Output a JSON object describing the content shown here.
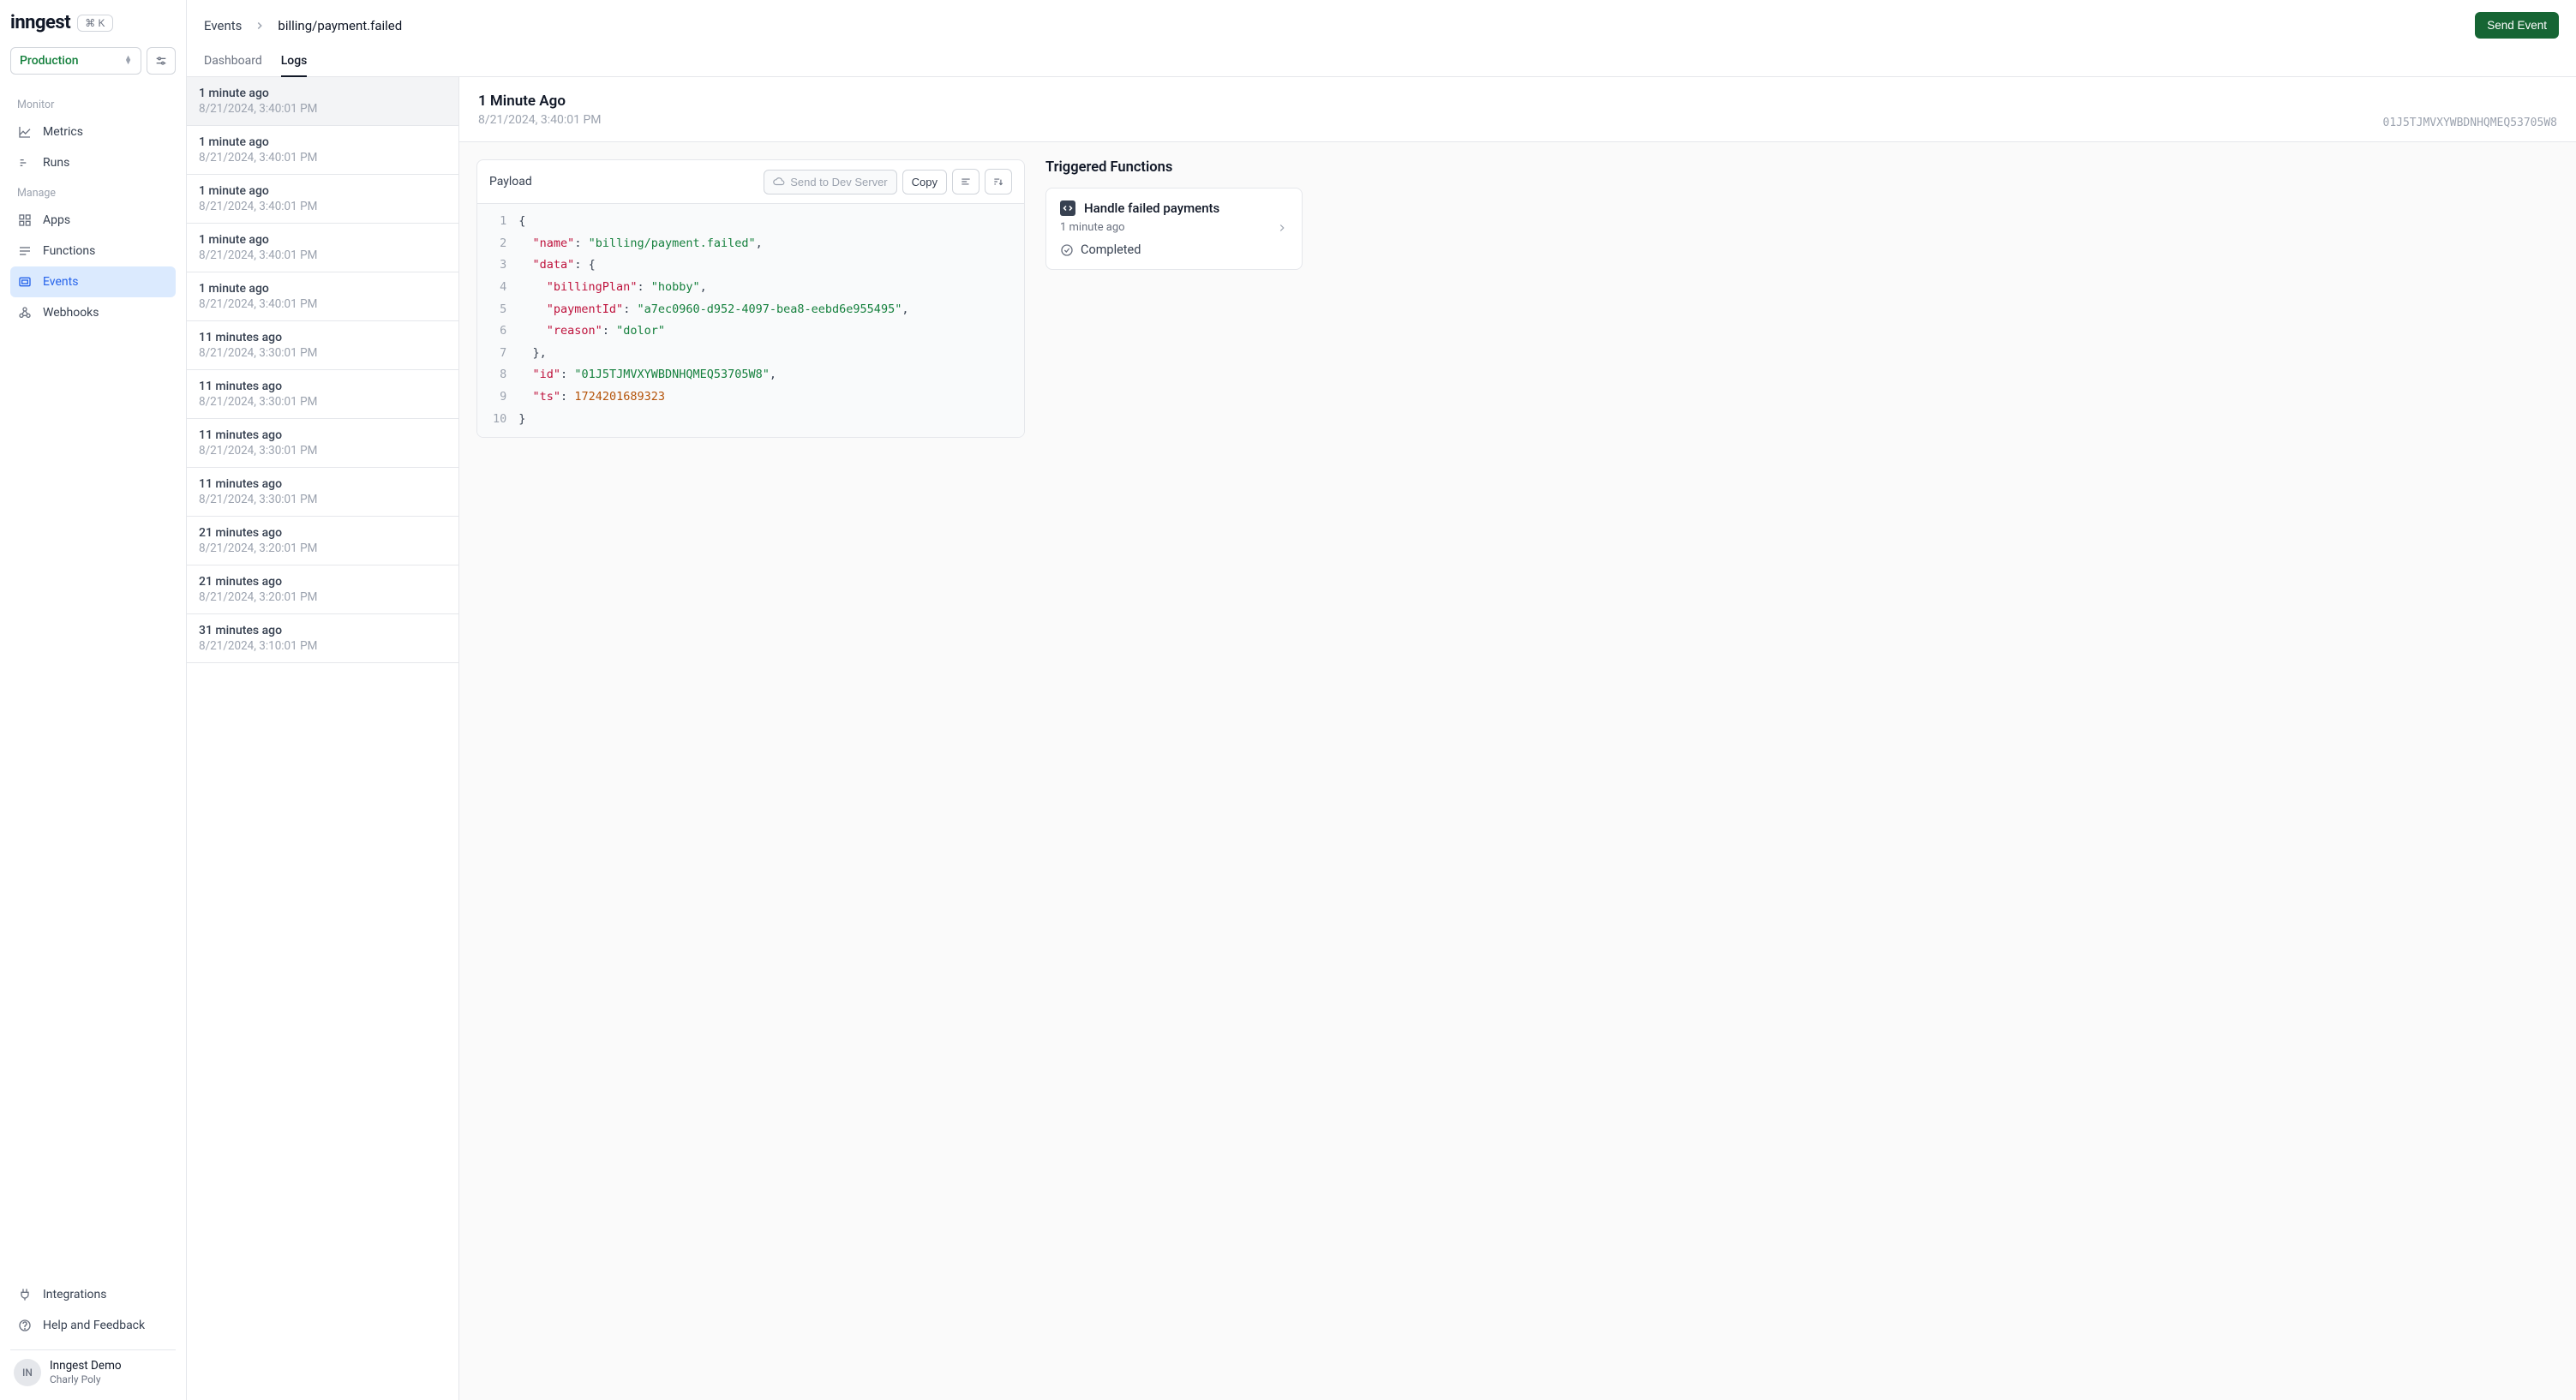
{
  "brand": "inngest",
  "shortcut": "⌘ K",
  "environment": "Production",
  "nav": {
    "monitor_label": "Monitor",
    "manage_label": "Manage",
    "metrics": "Metrics",
    "runs": "Runs",
    "apps": "Apps",
    "functions": "Functions",
    "events": "Events",
    "webhooks": "Webhooks",
    "integrations": "Integrations",
    "help": "Help and Feedback"
  },
  "user": {
    "initials": "IN",
    "org": "Inngest Demo",
    "name": "Charly Poly"
  },
  "header": {
    "breadcrumb_root": "Events",
    "breadcrumb_leaf": "billing/payment.failed",
    "send_event": "Send Event",
    "tab_dashboard": "Dashboard",
    "tab_logs": "Logs"
  },
  "logs": [
    {
      "rel": "1 minute ago",
      "abs": "8/21/2024, 3:40:01 PM",
      "selected": true
    },
    {
      "rel": "1 minute ago",
      "abs": "8/21/2024, 3:40:01 PM"
    },
    {
      "rel": "1 minute ago",
      "abs": "8/21/2024, 3:40:01 PM"
    },
    {
      "rel": "1 minute ago",
      "abs": "8/21/2024, 3:40:01 PM"
    },
    {
      "rel": "1 minute ago",
      "abs": "8/21/2024, 3:40:01 PM"
    },
    {
      "rel": "11 minutes ago",
      "abs": "8/21/2024, 3:30:01 PM"
    },
    {
      "rel": "11 minutes ago",
      "abs": "8/21/2024, 3:30:01 PM"
    },
    {
      "rel": "11 minutes ago",
      "abs": "8/21/2024, 3:30:01 PM"
    },
    {
      "rel": "11 minutes ago",
      "abs": "8/21/2024, 3:30:01 PM"
    },
    {
      "rel": "21 minutes ago",
      "abs": "8/21/2024, 3:20:01 PM"
    },
    {
      "rel": "21 minutes ago",
      "abs": "8/21/2024, 3:20:01 PM"
    },
    {
      "rel": "31 minutes ago",
      "abs": "8/21/2024, 3:10:01 PM"
    }
  ],
  "detail": {
    "title": "1 Minute Ago",
    "subtitle": "8/21/2024, 3:40:01 PM",
    "id": "01J5TJMVXYWBDNHQMEQ53705W8",
    "payload_label": "Payload",
    "send_dev": "Send to Dev Server",
    "copy": "Copy",
    "payload": {
      "name": "billing/payment.failed",
      "data": {
        "billingPlan": "hobby",
        "paymentId": "a7ec0960-d952-4097-bea8-eebd6e955495",
        "reason": "dolor"
      },
      "id": "01J5TJMVXYWBDNHQMEQ53705W8",
      "ts": 1724201689323
    },
    "triggered_title": "Triggered Functions",
    "fn": {
      "name": "Handle failed payments",
      "time": "1 minute ago",
      "status": "Completed"
    }
  }
}
